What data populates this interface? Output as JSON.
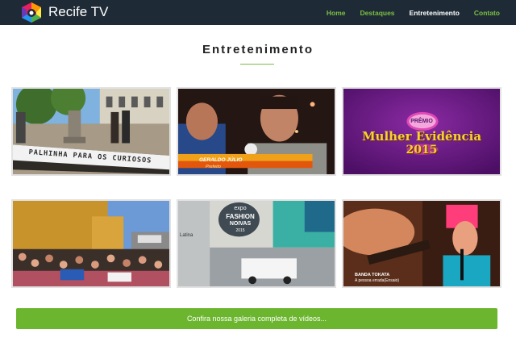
{
  "navbar": {
    "brand": "Recife TV",
    "logo_icon": "rainbow-camera-icon",
    "links": [
      {
        "label": "Home",
        "active": false
      },
      {
        "label": "Destaques",
        "active": false
      },
      {
        "label": "Entretenimento",
        "active": true
      },
      {
        "label": "Contato",
        "active": false
      }
    ]
  },
  "section": {
    "title": "Entretenimento"
  },
  "videos": [
    {
      "caption": "PALHINHA PARA OS CURIOSOS"
    },
    {
      "lower_third_name": "GERALDO JÚLIO",
      "lower_third_role": "Prefeito"
    },
    {
      "badge": "PRÊMIO",
      "title_line1": "Mulher Evidência",
      "year": "2015"
    },
    {},
    {
      "logo_top": "expo",
      "logo_mid": "FASHION",
      "logo_sub": "NOIVAS",
      "logo_year": "2015",
      "side_text": "Latina"
    },
    {
      "caption_line1": "BANDA TOKATA",
      "caption_line2": "A pessoa errada(Ensaio)"
    }
  ],
  "gallery_button": {
    "label": "Confira nossa galeria completa de vídeos..."
  },
  "colors": {
    "navbar_bg": "#1e2a36",
    "accent_green": "#7bc043",
    "button_green": "#6cb62f"
  }
}
